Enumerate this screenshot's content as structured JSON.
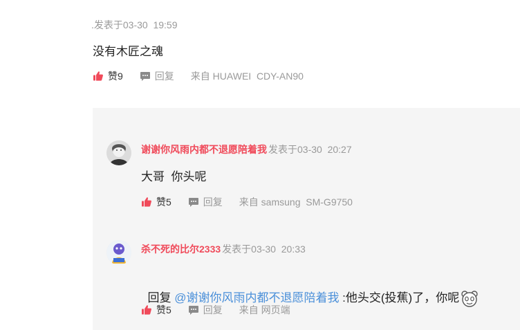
{
  "main_comment": {
    "meta": ".发表于03-30  19:59",
    "text": "没有木匠之魂",
    "like_label": "赞",
    "like_count": "9",
    "reply_label": "回复",
    "device": "来自 HUAWEI  CDY-AN90"
  },
  "replies": [
    {
      "username": "谢谢你风雨内都不退愿陪着我",
      "time": "发表于03-30  20:27",
      "text": "大哥  你头呢",
      "like_label": "赞",
      "like_count": "5",
      "reply_label": "回复",
      "device": "来自 samsung  SM-G9750",
      "avatar_icon": "avatar-woman-icon"
    },
    {
      "username": "杀不死的比尔2333",
      "time": "发表于03-30  20:33",
      "reply_prefix": "回复 ",
      "mention": "@谢谢你风雨内都不退愿陪着我",
      "text": " :他头交(投蕉)了，你呢",
      "emoji_icon": "panda-face-emoji-icon",
      "like_label": "赞",
      "like_count": "5",
      "reply_label": "回复",
      "device": "来自 网页端",
      "avatar_icon": "avatar-cartoon-character-icon"
    }
  ],
  "colors": {
    "accent": "#f04a5a",
    "mention": "#4a8fd9",
    "panel_bg": "#f5f5f5",
    "muted": "#999999"
  }
}
